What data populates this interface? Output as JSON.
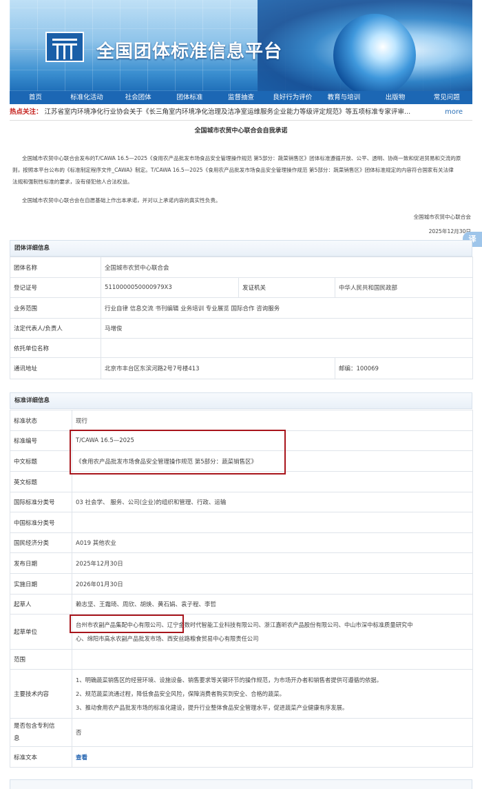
{
  "site": {
    "title": "全国团体标准信息平台"
  },
  "nav": [
    "首页",
    "标准化活动",
    "社会团体",
    "团体标准",
    "监督抽查",
    "良好行为评价",
    "教育与培训",
    "出版物",
    "常见问题"
  ],
  "ticker": {
    "label": "热点关注：",
    "text": "江苏省室内环境净化行业协会关于《长三角室内环境净化治理及洁净室运维服务企业能力等级评定规范》等五项标准专家评审...",
    "more": "more"
  },
  "declaration": {
    "title": "全国城市农贸中心联合会自我承诺",
    "para1a": "全国城市农贸中心联合会发布的T/CAWA 16.5—2025《食用农产品批发市场食品安全管理操作规范 第5部分：蔬菜销售区》团体标准遵循开放、公平、透明、协商一致和促进贸易和交流的原",
    "para1b": "则，按照本平台公布的《标准制定程序文件_CAWA》制定。T/CAWA 16.5—2025《食用农产品批发市场食品安全管理操作规范 第5部分：蔬菜销售区》团体标准规定的内容符合国家有关法律",
    "para1c": "法规和强制性标准的要求，没有侵犯他人合法权益。",
    "para2": "全国城市农贸中心联合会在自愿基础上作出本承诺，并对以上承诺内容的真实性负责。",
    "signer": "全国城市农贸中心联合会",
    "date": "2025年12月30日"
  },
  "side_tab": "译",
  "org": {
    "section_title": "团体详细信息",
    "name_label": "团体名称",
    "name": "全国城市农贸中心联合会",
    "reg_label": "登记证号",
    "reg": "5110000050000979X3",
    "issuer_label": "发证机关",
    "issuer": "中华人民共和国民政部",
    "scope_label": "业务范围",
    "scope": "行业自律 信息交流 书刊编辑 业务培训 专业展览 国际合作 咨询服务",
    "rep_label": "法定代表人/负责人",
    "rep": "马增俊",
    "entrust_label": "依托单位名称",
    "entrust": "",
    "addr_label": "通讯地址",
    "addr": "北京市丰台区东滨河路2号7号楼413",
    "postcode": "邮编：100069"
  },
  "standard": {
    "section_title": "标准详细信息",
    "rows": [
      {
        "k": "标准状态",
        "v": "现行"
      },
      {
        "k": "标准编号",
        "v": "T/CAWA 16.5—2025"
      },
      {
        "k": "中文标题",
        "v": "《食用农产品批发市场食品安全管理操作规范 第5部分：蔬菜销售区》"
      },
      {
        "k": "英文标题",
        "v": ""
      },
      {
        "k": "国际标准分类号",
        "v": "03 社会学、 服务、公司(企业)的组织和管理、行政、运输"
      },
      {
        "k": "中国标准分类号",
        "v": ""
      },
      {
        "k": "国民经济分类",
        "v": "A019 其他农业"
      },
      {
        "k": "发布日期",
        "v": "2025年12月30日"
      },
      {
        "k": "实施日期",
        "v": "2026年01月30日"
      },
      {
        "k": "起草人",
        "v": "赖志坚、王霜琦、周欣、胡焕、黄石娟、袁子程、李哲"
      },
      {
        "k": "起草单位",
        "v1": "台州市农副产品集配中心有限公司、辽宁金数时代智能工业科技有限公司、浙江嘉昕农产品股份有限公司、中山市深中标准质量研究中",
        "v2": "心、绵阳市高水农副产品批发市场、西安丝路粮食贸易中心有限责任公司"
      },
      {
        "k": "范围",
        "v": ""
      },
      {
        "k": "主要技术内容",
        "v1": "1、明确蔬菜销售区的经营环境、设施设备、销售要求等关键环节的操作规范，为市场开办者和销售者提供可遵循的依据。",
        "v2": "2、规范蔬菜流通过程，降低食品安全风险，保障消费者购买到安全、合格的蔬菜。",
        "v3": "3、推动食用农产品批发市场的标准化建设，提升行业整体食品安全管理水平，促进蔬菜产业健康有序发展。"
      },
      {
        "k1": "是否包含专利信",
        "k2": "息",
        "v": "否"
      },
      {
        "k": "标准文本",
        "v": "查看"
      }
    ]
  }
}
